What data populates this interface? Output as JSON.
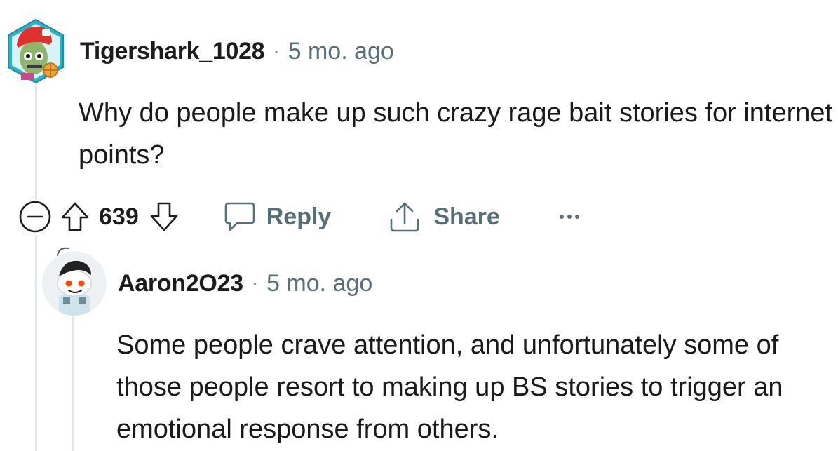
{
  "comments": [
    {
      "username": "Tigershark_1028",
      "separator": "·",
      "timestamp": "5 mo. ago",
      "body": "Why do people make up such crazy rage bait stories for internet points?",
      "votes": "639",
      "reply_label": "Reply",
      "share_label": "Share",
      "more_label": "···"
    },
    {
      "username": "Aaron2O23",
      "separator": "·",
      "timestamp": "5 mo. ago",
      "body": "Some people crave attention, and unfortunately some of those people resort to making up BS stories to trigger an emotional response from others."
    }
  ],
  "icons": {
    "collapse": "collapse-icon",
    "upvote": "upvote-icon",
    "downvote": "downvote-icon",
    "reply": "comment-bubble-icon",
    "share": "share-icon",
    "more": "more-icon"
  },
  "colors": {
    "meta_gray": "#576f76",
    "thread_line": "#e3e6e8",
    "text": "#1c1c1c"
  }
}
